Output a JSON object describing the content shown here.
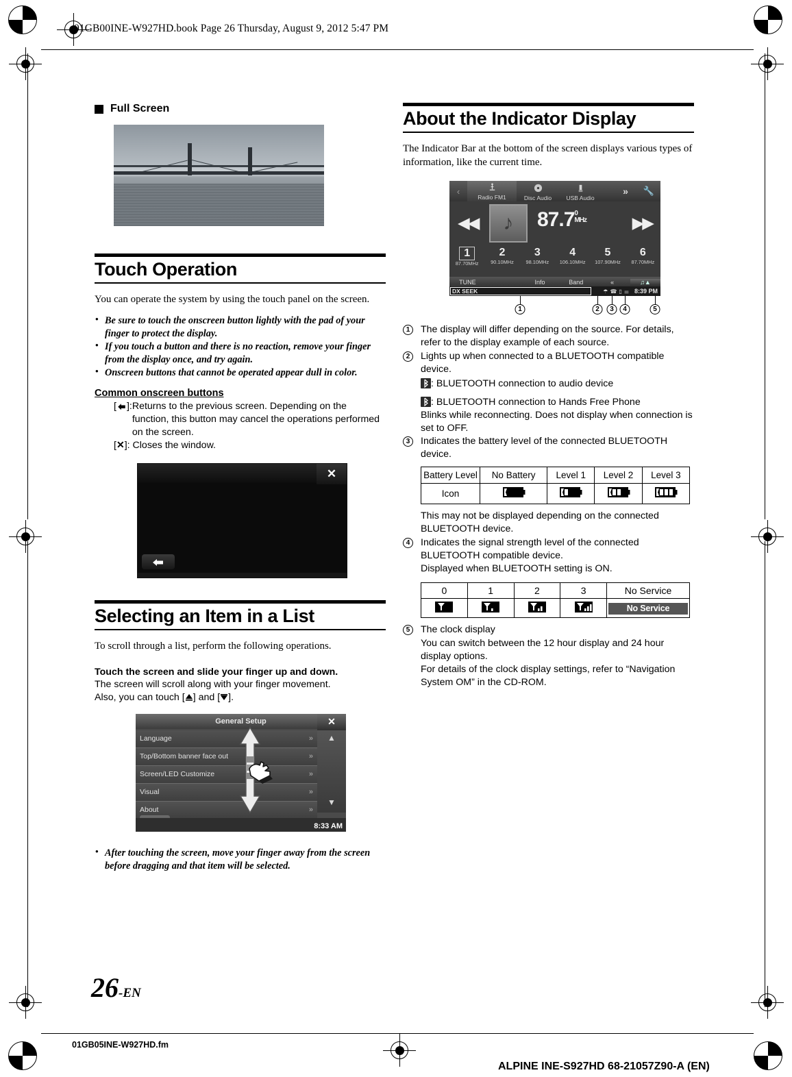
{
  "page": {
    "book_header": "01GB00INE-W927HD.book  Page 26  Thursday, August 9, 2012  5:47 PM",
    "page_number": "26",
    "page_lang": "-EN",
    "fm_name": "01GB05INE-W927HD.fm",
    "alpine_code": "ALPINE INE-S927HD 68-21057Z90-A (EN)"
  },
  "left": {
    "full_screen_heading": "Full Screen",
    "touch_operation": {
      "title": "Touch Operation",
      "intro": "You can operate the system by using the touch panel on the screen.",
      "notes": [
        "Be sure to touch the onscreen button lightly with the pad of your finger to protect the display.",
        "If you touch a button and there is no reaction, remove your finger from the display once, and try again.",
        "Onscreen buttons that cannot be operated appear dull in color."
      ],
      "common_buttons_heading": "Common onscreen buttons",
      "back_key": "]:",
      "back_desc": "Returns to the previous screen. Depending on the function, this button may cancel the operations performed on the screen.",
      "close_key": "]:",
      "close_desc": "Closes the window.",
      "black_screen": {
        "close_icon": "close-icon",
        "back_icon": "back-icon"
      }
    },
    "selecting_item": {
      "title": "Selecting an Item in a List",
      "intro": "To scroll through a list, perform the following operations.",
      "bold_line": "Touch the screen and slide your finger up and down.",
      "line2": "The screen will scroll along with your finger movement.",
      "line3_prefix": "Also, you can touch [",
      "line3_mid": "] and [",
      "line3_suffix": "].",
      "note": "After touching the screen, move your finger away from the screen before dragging and that item will be selected."
    },
    "setup_screen": {
      "title": "General Setup",
      "close_icon": "close-icon",
      "items": [
        {
          "label": "Language",
          "chevron": "»"
        },
        {
          "label": "Top/Bottom banner face out",
          "chevron": "»"
        },
        {
          "label": "Screen/LED Customize",
          "chevron": "»"
        },
        {
          "label": "Visual",
          "chevron": "»"
        },
        {
          "label": "About",
          "chevron": "»"
        }
      ],
      "clock": "8:33 AM",
      "back_icon": "back-icon"
    }
  },
  "right": {
    "indicator_display": {
      "title": "About the Indicator Display",
      "intro": "The Indicator Bar at the bottom of the screen displays various types of information, like the current time."
    },
    "radio_screen": {
      "tabs": [
        {
          "label": "Radio FM1",
          "icon": "antenna-icon"
        },
        {
          "label": "Disc Audio",
          "icon": "disc-icon"
        },
        {
          "label": "USB Audio",
          "icon": "usb-icon"
        }
      ],
      "frequency": "87.7",
      "frequency_trailing": "0",
      "unit": "MHz",
      "prev_icon": "previous-track-icon",
      "next_icon": "next-track-icon",
      "album_art_icon": "music-note-icon",
      "presets": [
        {
          "num": "1",
          "freq": "87.70MHz"
        },
        {
          "num": "2",
          "freq": "90.10MHz"
        },
        {
          "num": "3",
          "freq": "98.10MHz"
        },
        {
          "num": "4",
          "freq": "106.10MHz"
        },
        {
          "num": "5",
          "freq": "107.90MHz"
        },
        {
          "num": "6",
          "freq": "87.70MHz"
        }
      ],
      "function_bar": [
        "TUNE",
        "",
        "Info",
        "Band",
        "«"
      ],
      "dx_seek": "DX SEEK",
      "clock": "8:39 PM"
    },
    "callouts": [
      "1",
      "2",
      "3",
      "4",
      "5"
    ],
    "notes": [
      {
        "num": "1",
        "text": "The display will differ depending on the source. For details, refer to the display example of each source."
      },
      {
        "num": "2",
        "text": "Lights up when connected to a BLUETOOTH compatible device."
      },
      {
        "num": "3",
        "text": "Indicates the battery level of the connected BLUETOOTH device."
      },
      {
        "num": "4",
        "text": "Indicates the signal strength level of the connected BLUETOOTH compatible device."
      },
      {
        "num": "5",
        "text": "The clock display"
      }
    ],
    "bt_audio_line": ": BLUETOOTH connection to audio device",
    "bt_phone_line": ": BLUETOOTH connection to Hands Free Phone",
    "bt_blink_line": "Blinks while reconnecting. Does not display when connection is set to OFF.",
    "battery_note": "This may not be displayed depending on the connected BLUETOOTH device.",
    "signal_note": "Displayed when BLUETOOTH setting is ON.",
    "clock_lines": [
      "You can switch between the 12 hour display and 24 hour display options.",
      "For details of the clock display settings, refer to “Navigation System OM” in the CD-ROM."
    ],
    "battery_table": {
      "headers": [
        "Battery Level",
        "No Battery",
        "Level 1",
        "Level 2",
        "Level 3"
      ],
      "row_label": "Icon",
      "levels": [
        0,
        1,
        2,
        3
      ]
    },
    "signal_table": {
      "headers": [
        "0",
        "1",
        "2",
        "3",
        "No Service"
      ],
      "bars": [
        0,
        1,
        2,
        3
      ],
      "no_service_label": "No Service"
    }
  }
}
